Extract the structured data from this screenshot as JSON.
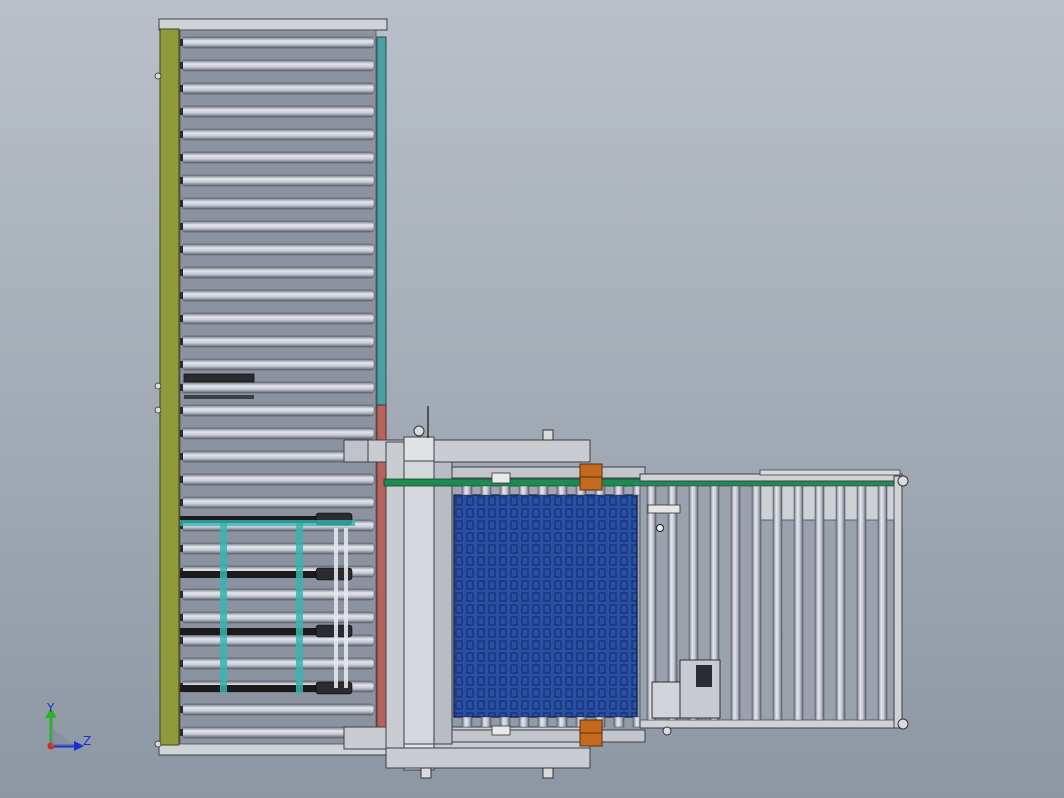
{
  "viewport": {
    "background_top": "#b9c0c9",
    "background_bottom": "#8d97a3"
  },
  "colors": {
    "frame_light": "#cfd2d6",
    "frame_dark": "#4b4f55",
    "roller_light": "#e4e7ee",
    "roller_mid": "#a3a9b6",
    "roller_dark": "#6d7280",
    "side_rail_olive": "#8f9a3a",
    "side_rail_teal": "#4aa0a0",
    "side_rail_red": "#b7635c",
    "belt_blue": "#2a4fa6",
    "belt_slot": "#16306e",
    "guide_green": "#1f8a52",
    "bracket_orange": "#c46a1f",
    "chain_black": "#1b1b1b",
    "lift_teal": "#35b5b0"
  },
  "axis_triad": {
    "x_axis_label": "Y",
    "y_axis_label": "Z",
    "axis_color": "#1a2fd6",
    "origin_color": "#d02b2b",
    "y_arrow_color": "#2bb02b"
  }
}
